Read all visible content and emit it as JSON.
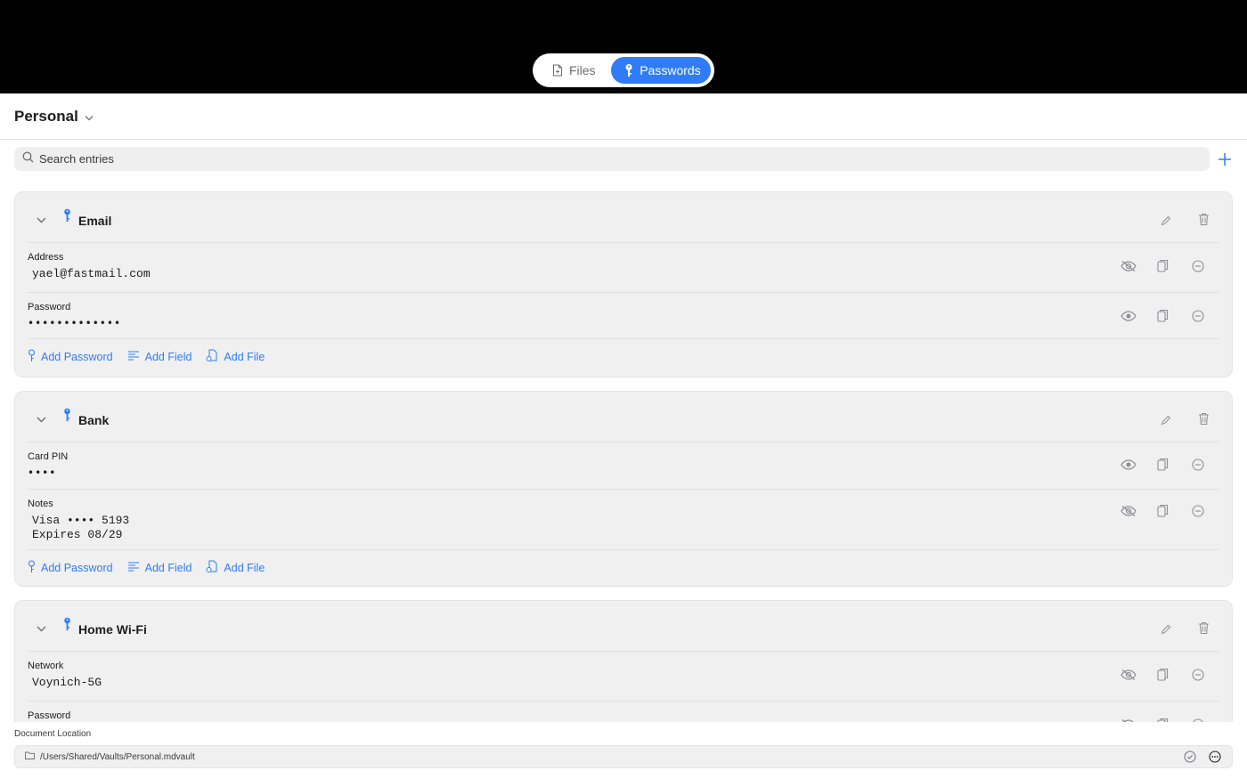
{
  "top_tabs": {
    "files": "Files",
    "passwords": "Passwords",
    "active": "passwords"
  },
  "vault": {
    "title": "Personal"
  },
  "search": {
    "placeholder": "Search entries"
  },
  "entries": [
    {
      "title": "Email",
      "fields": [
        {
          "label": "Address",
          "value": "yael@fastmail.com",
          "concealed": false
        },
        {
          "label": "Password",
          "value": "•••••••••••••",
          "concealed": true
        }
      ]
    },
    {
      "title": "Bank",
      "fields": [
        {
          "label": "Card PIN",
          "value": "••••",
          "concealed": true
        },
        {
          "label": "Notes",
          "value": "Visa •••• 5193\nExpires 08/29",
          "concealed": false
        }
      ]
    },
    {
      "title": "Home Wi-Fi",
      "fields": [
        {
          "label": "Network",
          "value": "Voynich-5G",
          "concealed": false
        },
        {
          "label": "Password",
          "value": "",
          "concealed": true
        }
      ]
    }
  ],
  "card_actions": {
    "add_password": "Add Password",
    "add_field": "Add Field",
    "add_file": "Add File"
  },
  "document": {
    "label": "Document Location",
    "path": "/Users/Shared/Vaults/Personal.mdvault"
  },
  "colors": {
    "accent": "#2f7cf6",
    "topbar": "#000000",
    "card_bg": "#f0f0f1"
  }
}
